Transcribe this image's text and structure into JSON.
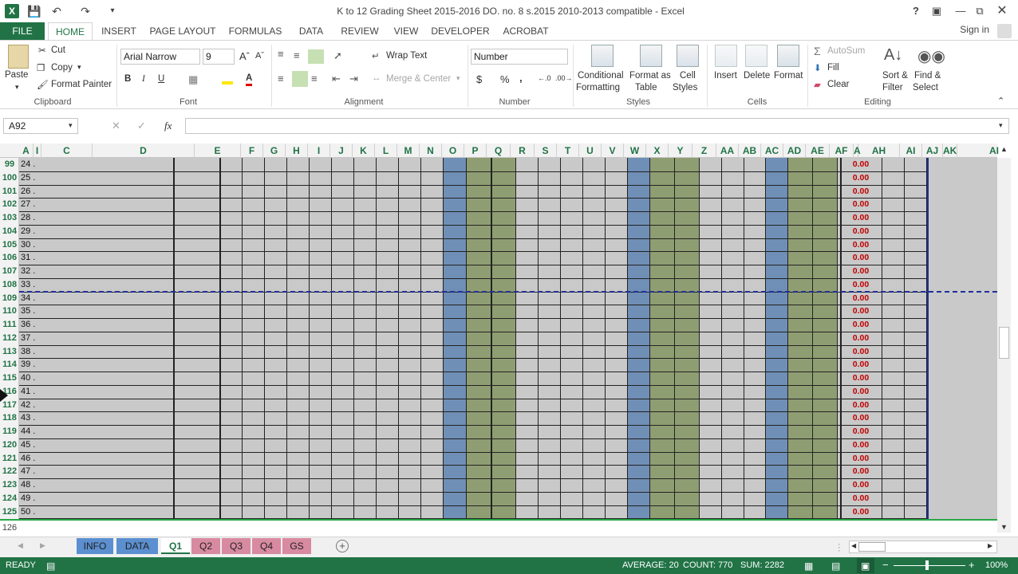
{
  "window": {
    "title": "K to 12 Grading Sheet 2015-2016  DO. no. 8 s.2015  2010-2013 compatible - Excel",
    "help": "?",
    "app_icon": "X"
  },
  "ribbon_tabs": [
    "FILE",
    "HOME",
    "INSERT",
    "PAGE LAYOUT",
    "FORMULAS",
    "DATA",
    "REVIEW",
    "VIEW",
    "DEVELOPER",
    "ACROBAT"
  ],
  "signin": "Sign in",
  "clipboard": {
    "paste": "Paste",
    "cut": "Cut",
    "copy": "Copy",
    "format_painter": "Format Painter",
    "group": "Clipboard"
  },
  "font": {
    "name": "Arial Narrow",
    "size": "9",
    "bold": "B",
    "italic": "I",
    "underline": "U",
    "group": "Font"
  },
  "alignment": {
    "wrap": "Wrap Text",
    "merge": "Merge & Center",
    "group": "Alignment"
  },
  "number": {
    "format": "Number",
    "currency": "$",
    "percent": "%",
    "comma": ",",
    "group": "Number"
  },
  "styles": {
    "conditional": "Conditional",
    "conditional2": "Formatting",
    "format_table": "Format as",
    "format_table2": "Table",
    "cell_styles": "Cell",
    "cell_styles2": "Styles",
    "group": "Styles"
  },
  "cells": {
    "insert": "Insert",
    "delete": "Delete",
    "format": "Format",
    "group": "Cells"
  },
  "editing": {
    "autosum": "AutoSum",
    "fill": "Fill",
    "clear": "Clear",
    "sort": "Sort &",
    "sort2": "Filter",
    "find": "Find &",
    "find2": "Select",
    "group": "Editing"
  },
  "formula_bar": {
    "name_box": "A92",
    "fx": "fx",
    "value": ""
  },
  "columns": [
    "A",
    "I",
    "C",
    "D",
    "E",
    "F",
    "G",
    "H",
    "I",
    "J",
    "K",
    "L",
    "M",
    "N",
    "O",
    "P",
    "Q",
    "R",
    "S",
    "T",
    "U",
    "V",
    "W",
    "X",
    "Y",
    "Z",
    "AA",
    "AB",
    "AC",
    "AD",
    "AE",
    "AF",
    "A",
    "AH",
    "AI",
    "AJ",
    "AK",
    "AI"
  ],
  "rows": [
    {
      "num": "99",
      "c": "24 ."
    },
    {
      "num": "100",
      "c": "25 ."
    },
    {
      "num": "101",
      "c": "26 ."
    },
    {
      "num": "102",
      "c": "27 ."
    },
    {
      "num": "103",
      "c": "28 ."
    },
    {
      "num": "104",
      "c": "29 ."
    },
    {
      "num": "105",
      "c": "30 ."
    },
    {
      "num": "106",
      "c": "31 ."
    },
    {
      "num": "107",
      "c": "32 ."
    },
    {
      "num": "108",
      "c": "33 ."
    },
    {
      "num": "109",
      "c": "34 ."
    },
    {
      "num": "110",
      "c": "35 ."
    },
    {
      "num": "111",
      "c": "36 ."
    },
    {
      "num": "112",
      "c": "37 ."
    },
    {
      "num": "113",
      "c": "38 ."
    },
    {
      "num": "114",
      "c": "39 ."
    },
    {
      "num": "115",
      "c": "40 ."
    },
    {
      "num": "116",
      "c": "41 ."
    },
    {
      "num": "117",
      "c": "42 ."
    },
    {
      "num": "118",
      "c": "43 ."
    },
    {
      "num": "119",
      "c": "44 ."
    },
    {
      "num": "120",
      "c": "45 ."
    },
    {
      "num": "121",
      "c": "46 ."
    },
    {
      "num": "122",
      "c": "47 ."
    },
    {
      "num": "123",
      "c": "48 ."
    },
    {
      "num": "124",
      "c": "49 ."
    },
    {
      "num": "125",
      "c": "50 ."
    }
  ],
  "ah_value": "0.00",
  "last_row": "126",
  "sheet_tabs": [
    {
      "label": "INFO",
      "color": "#5b8fd0"
    },
    {
      "label": "DATA",
      "color": "#5b8fd0"
    },
    {
      "label": "Q1",
      "color": "#ffffff"
    },
    {
      "label": "Q2",
      "color": "#d88aa0"
    },
    {
      "label": "Q3",
      "color": "#d88aa0"
    },
    {
      "label": "Q4",
      "color": "#d88aa0"
    },
    {
      "label": "GS",
      "color": "#d88aa0"
    }
  ],
  "status": {
    "ready": "READY",
    "average": "AVERAGE: 20",
    "count": "COUNT: 770",
    "sum": "SUM: 2282",
    "zoom": "100%"
  },
  "colors": {
    "excel_green": "#217346",
    "blue_col": "#6f8fb6",
    "green_col": "#8f9e72",
    "grid_bg": "#c9c9c9",
    "ah_text": "#c00000"
  }
}
